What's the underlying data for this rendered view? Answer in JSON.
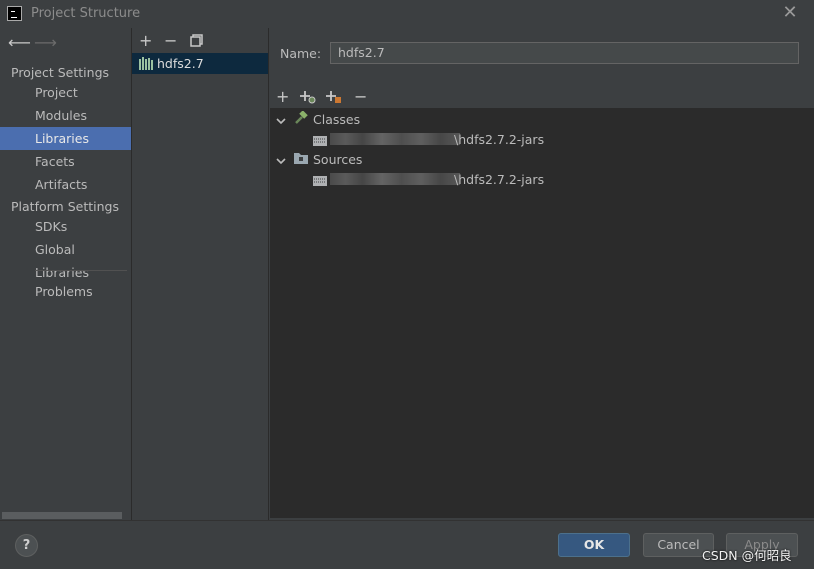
{
  "window": {
    "title": "Project Structure",
    "close_icon": "close-icon"
  },
  "nav": {
    "back_icon": "arrow-left-icon",
    "forward_icon": "arrow-right-icon",
    "project_settings_header": "Project Settings",
    "project_items": [
      "Project",
      "Modules",
      "Libraries",
      "Facets",
      "Artifacts"
    ],
    "platform_settings_header": "Platform Settings",
    "platform_items": [
      "SDKs",
      "Global Libraries"
    ],
    "problems": "Problems",
    "selected": "Libraries"
  },
  "library_list": {
    "toolbar": {
      "add": "+",
      "remove": "−",
      "copy_icon": "copy-icon"
    },
    "items": [
      {
        "label": "hdfs2.7",
        "icon": "library-icon"
      }
    ]
  },
  "details": {
    "name_label": "Name:",
    "name_value": "hdfs2.7",
    "toolbar": {
      "add": "+",
      "remove": "−"
    },
    "tree": {
      "classes_label": "Classes",
      "classes_path": "\\hdfs2.7.2-jars",
      "sources_label": "Sources",
      "sources_path": "\\hdfs2.7.2-jars"
    }
  },
  "footer": {
    "help": "?",
    "ok": "OK",
    "cancel": "Cancel",
    "apply": "Apply"
  },
  "watermark": "CSDN @何昭良",
  "colors": {
    "selection": "#4b6eaf",
    "ok_button": "#365880",
    "background": "#3c3f41",
    "tree_bg": "#2b2b2b"
  }
}
